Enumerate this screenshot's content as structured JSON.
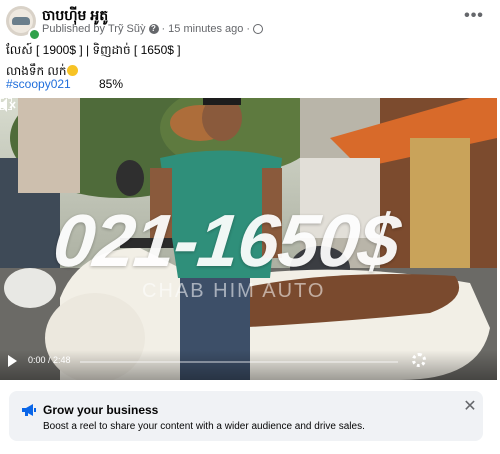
{
  "post": {
    "page_name": "ចាបហ៊ីម អូតូ",
    "published_by_prefix": "Published by",
    "author": "Trỹ Sũỳ",
    "time": "15 minutes ago",
    "line1": "លែស៍ [ 1900$ ]   | ទិញដាច់  [ 1650$ ]",
    "line2": "លាងទឹក លក់",
    "hashtag": "#scoopy021",
    "percent": "85%"
  },
  "video": {
    "overlay_title": "021-1650$",
    "watermark": "CHAB HIM AUTO",
    "time_display": "0:00 / 2:48",
    "progress": 0.0
  },
  "banner": {
    "title": "Grow your business",
    "text": "Boost a reel to share your content with a wider audience and drive sales."
  },
  "icons": {
    "more": "more-options-icon",
    "globe": "globe-icon",
    "question": "question-icon",
    "play": "play-icon",
    "settings": "gear-icon",
    "fullscreen": "fullscreen-icon",
    "mute": "mute-icon",
    "megaphone": "megaphone-icon",
    "close": "close-icon"
  },
  "colors": {
    "hashtag": "#216fdb",
    "megaphone": "#0a66e8",
    "online": "#31a24c"
  }
}
